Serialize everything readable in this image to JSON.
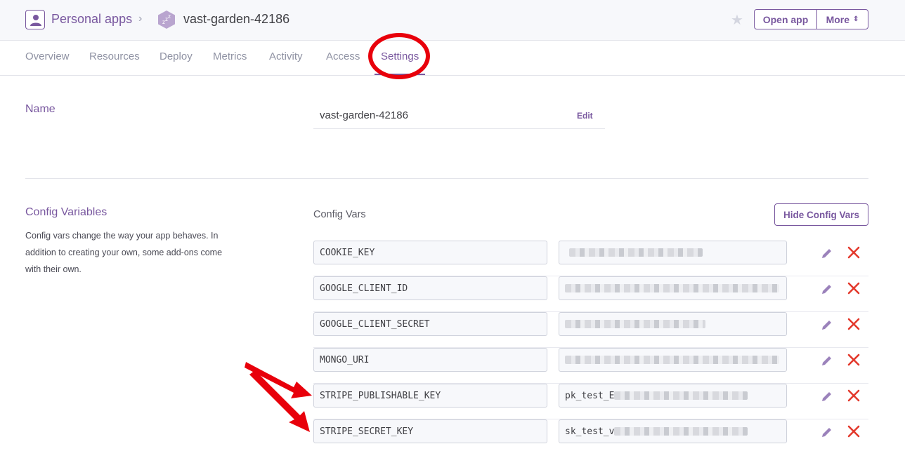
{
  "header": {
    "breadcrumb_personal": "Personal apps",
    "breadcrumb_separator": "›",
    "app_name": "vast-garden-42186",
    "open_app_label": "Open app",
    "more_label": "More",
    "accent_color": "#79589f"
  },
  "tabs": [
    {
      "label": "Overview"
    },
    {
      "label": "Resources"
    },
    {
      "label": "Deploy"
    },
    {
      "label": "Metrics"
    },
    {
      "label": "Activity"
    },
    {
      "label": "Access"
    },
    {
      "label": "Settings",
      "active": true
    }
  ],
  "name_section": {
    "label": "Name",
    "value": "vast-garden-42186",
    "edit_label": "Edit"
  },
  "config_section": {
    "label": "Config Variables",
    "description": "Config vars change the way your app behaves. In addition to creating your own, some add-ons come with their own.",
    "vars_title": "Config Vars",
    "hide_button_label": "Hide Config Vars",
    "vars": [
      {
        "key": "COOKIE_KEY",
        "value_prefix": ""
      },
      {
        "key": "GOOGLE_CLIENT_ID",
        "value_prefix": ""
      },
      {
        "key": "GOOGLE_CLIENT_SECRET",
        "value_prefix": ""
      },
      {
        "key": "MONGO_URI",
        "value_prefix": ""
      },
      {
        "key": "STRIPE_PUBLISHABLE_KEY",
        "value_prefix": "pk_test_E"
      },
      {
        "key": "STRIPE_SECRET_KEY",
        "value_prefix": "sk_test_v"
      }
    ]
  },
  "annotations": {
    "highlight_color": "#e8000b"
  }
}
